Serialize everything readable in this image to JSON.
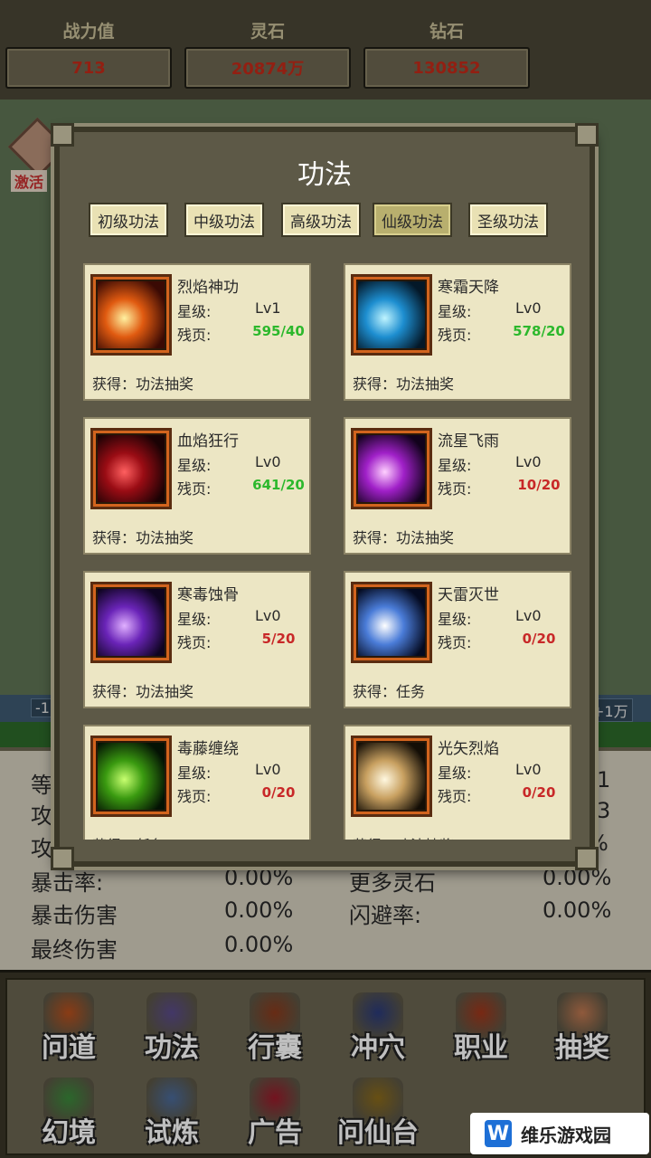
{
  "topbar": {
    "stats": [
      {
        "label": "战力值",
        "value": "713"
      },
      {
        "label": "灵石",
        "value": "20874万"
      },
      {
        "label": "钻石",
        "value": "130852"
      }
    ]
  },
  "background": {
    "activate_label": "激活",
    "band_left": "-1",
    "band_right": "+1万"
  },
  "attributes": {
    "left": [
      {
        "label": "等",
        "value": ""
      },
      {
        "label": "攻",
        "value": ""
      },
      {
        "label": "攻",
        "value": ""
      },
      {
        "label": "暴击率:",
        "value": "0.00%"
      },
      {
        "label": "暴击伤害",
        "value": "0.00%"
      },
      {
        "label": "最终伤害",
        "value": "0.00%"
      }
    ],
    "right": [
      {
        "label": "",
        "value": "1"
      },
      {
        "label": "",
        "value": "3"
      },
      {
        "label": "",
        "value": "%"
      },
      {
        "label": "更多灵石",
        "value": "0.00%"
      },
      {
        "label": "闪避率:",
        "value": "0.00%"
      }
    ]
  },
  "dialog": {
    "title": "功法",
    "tabs": [
      "初级功法",
      "中级功法",
      "高级功法",
      "仙级功法",
      "圣级功法"
    ],
    "active_tab": "仙级功法",
    "star_label": "星级:",
    "page_label": "残页:",
    "skills": [
      {
        "name": "烈焰神功",
        "star": "Lv1",
        "pages": "595/40",
        "status": "green",
        "source": "获得：功法抽奖",
        "icon": "fireball-icon",
        "color1": "#fff1a0",
        "color2": "#e05a10",
        "color3": "#3a0a04"
      },
      {
        "name": "寒霜天降",
        "star": "Lv0",
        "pages": "578/20",
        "status": "green",
        "source": "获得：功法抽奖",
        "icon": "frost-icon",
        "color1": "#bff4ff",
        "color2": "#1d8ed0",
        "color3": "#041828"
      },
      {
        "name": "血焰狂行",
        "star": "Lv0",
        "pages": "641/20",
        "status": "green",
        "source": "获得：功法抽奖",
        "icon": "blood-flame-icon",
        "color1": "#ff6060",
        "color2": "#9a0c14",
        "color3": "#1a0204"
      },
      {
        "name": "流星飞雨",
        "star": "Lv0",
        "pages": "10/20",
        "status": "red",
        "source": "获得：功法抽奖",
        "icon": "meteor-icon",
        "color1": "#ffd0ff",
        "color2": "#a020c8",
        "color3": "#12021c"
      },
      {
        "name": "寒毒蚀骨",
        "star": "Lv0",
        "pages": "5/20",
        "status": "red",
        "source": "获得：功法抽奖",
        "icon": "poison-bone-icon",
        "color1": "#e0b0ff",
        "color2": "#6a24b8",
        "color3": "#0e0420"
      },
      {
        "name": "天雷灭世",
        "star": "Lv0",
        "pages": "0/20",
        "status": "red",
        "source": "获得：任务",
        "icon": "thunder-icon",
        "color1": "#ffffff",
        "color2": "#4a7cd8",
        "color3": "#040a20"
      },
      {
        "name": "毒藤缠绕",
        "star": "Lv0",
        "pages": "0/20",
        "status": "red",
        "source": "获得：任务",
        "icon": "vine-icon",
        "color1": "#c8ff70",
        "color2": "#3a9a10",
        "color3": "#041204"
      },
      {
        "name": "光矢烈焰",
        "star": "Lv0",
        "pages": "0/20",
        "status": "red",
        "source": "获得：功法抽奖",
        "icon": "light-arrow-icon",
        "color1": "#fff8e0",
        "color2": "#c8a060",
        "color3": "#140e06"
      }
    ]
  },
  "nav": [
    {
      "label": "问道",
      "icon": "sword-icon",
      "color": "#b8501c"
    },
    {
      "label": "功法",
      "icon": "book-icon",
      "color": "#5a4a8a"
    },
    {
      "label": "行囊",
      "icon": "bag-icon",
      "color": "#8a3a1c"
    },
    {
      "label": "冲穴",
      "icon": "meridian-icon",
      "color": "#2a3a7a"
    },
    {
      "label": "职业",
      "icon": "weapon-icon",
      "color": "#a0361a"
    },
    {
      "label": "抽奖",
      "icon": "scroll-icon",
      "color": "#c07850"
    },
    {
      "label": "幻境",
      "icon": "crystal-icon",
      "color": "#3a8a3a"
    },
    {
      "label": "试炼",
      "icon": "horn-icon",
      "color": "#4a6a9a"
    },
    {
      "label": "广告",
      "icon": "gem-icon",
      "color": "#9a1a2a"
    },
    {
      "label": "问仙台",
      "icon": "altar-icon",
      "color": "#8a6a1a"
    }
  ],
  "watermark": {
    "logo": "W",
    "text": "维乐游戏园"
  }
}
